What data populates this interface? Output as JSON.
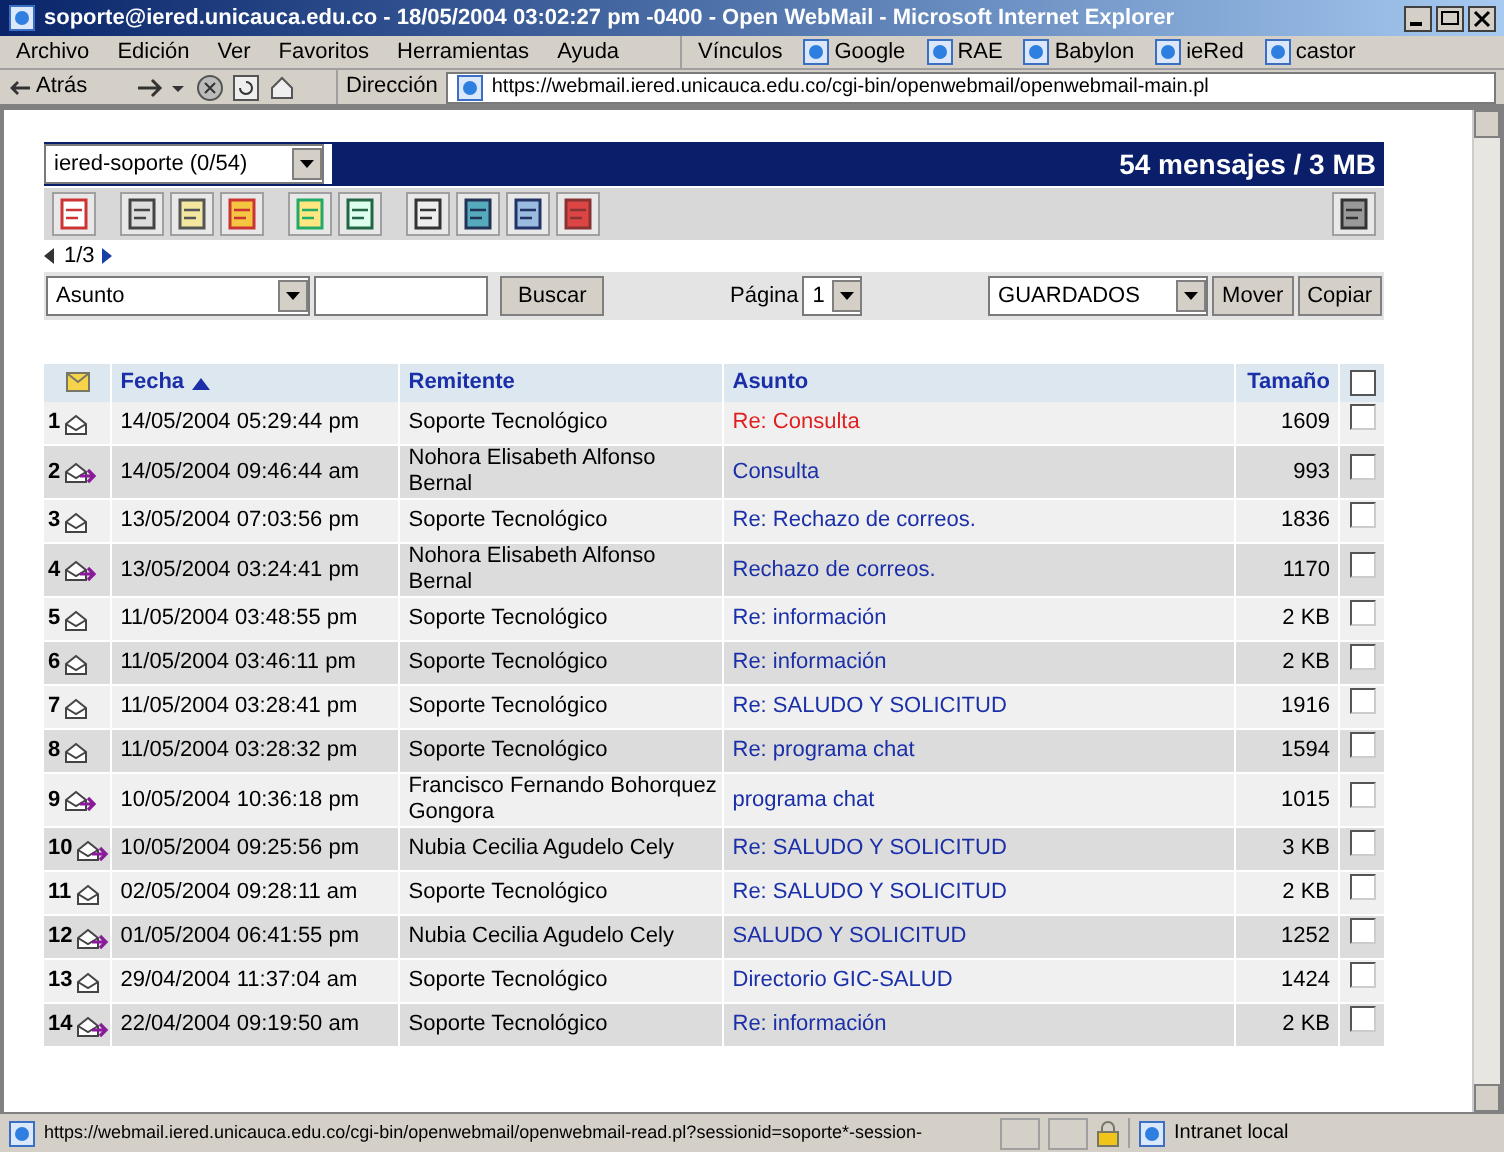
{
  "window": {
    "title": "soporte@iered.unicauca.edu.co - 18/05/2004 03:02:27 pm -0400 - Open WebMail - Microsoft Internet Explorer"
  },
  "menu": [
    "Archivo",
    "Edición",
    "Ver",
    "Favoritos",
    "Herramientas",
    "Ayuda"
  ],
  "links": {
    "label": "Vínculos",
    "items": [
      "Google",
      "RAE",
      "Babylon",
      "ieRed",
      "castor"
    ]
  },
  "nav": {
    "back": "Atrás",
    "address_label": "Dirección",
    "address": "https://webmail.iered.unicauca.edu.co/cgi-bin/openwebmail/openwebmail-main.pl"
  },
  "folder": {
    "value": "iered-soporte (0/54)",
    "summary": "54 mensajes / 3 MB"
  },
  "pager": "1/3",
  "search": {
    "field": "Asunto",
    "button": "Buscar",
    "page_label": "Página",
    "page": "1",
    "target": "GUARDADOS",
    "move": "Mover",
    "copy": "Copiar"
  },
  "table": {
    "columns": [
      "Fecha",
      "Remitente",
      "Asunto",
      "Tamaño"
    ],
    "select_all": {
      "checked": false
    },
    "rows": [
      {
        "num": "1",
        "kind": "plain",
        "date": "14/05/2004 05:29:44 pm",
        "sender": "Soporte Tecnológico",
        "subject": "Re: Consulta",
        "size": "1609",
        "current": true,
        "checked": false
      },
      {
        "num": "2",
        "kind": "arrow",
        "date": "14/05/2004 09:46:44 am",
        "sender": "Nohora Elisabeth Alfonso Bernal",
        "subject": "Consulta",
        "size": "993",
        "current": false,
        "checked": false
      },
      {
        "num": "3",
        "kind": "plain",
        "date": "13/05/2004 07:03:56 pm",
        "sender": "Soporte Tecnológico",
        "subject": "Re: Rechazo de correos.",
        "size": "1836",
        "current": false,
        "checked": false
      },
      {
        "num": "4",
        "kind": "arrow",
        "date": "13/05/2004 03:24:41 pm",
        "sender": "Nohora Elisabeth Alfonso Bernal",
        "subject": "Rechazo de correos.",
        "size": "1170",
        "current": false,
        "checked": false
      },
      {
        "num": "5",
        "kind": "plain",
        "date": "11/05/2004 03:48:55 pm",
        "sender": "Soporte Tecnológico",
        "subject": "Re: información",
        "size": "2 KB",
        "current": false,
        "checked": false
      },
      {
        "num": "6",
        "kind": "plain",
        "date": "11/05/2004 03:46:11 pm",
        "sender": "Soporte Tecnológico",
        "subject": "Re: información",
        "size": "2 KB",
        "current": false,
        "checked": false
      },
      {
        "num": "7",
        "kind": "plain",
        "date": "11/05/2004 03:28:41 pm",
        "sender": "Soporte Tecnológico",
        "subject": "Re: SALUDO Y SOLICITUD",
        "size": "1916",
        "current": false,
        "checked": false
      },
      {
        "num": "8",
        "kind": "plain",
        "date": "11/05/2004 03:28:32 pm",
        "sender": "Soporte Tecnológico",
        "subject": "Re: programa chat",
        "size": "1594",
        "current": false,
        "checked": false
      },
      {
        "num": "9",
        "kind": "arrow",
        "date": "10/05/2004 10:36:18 pm",
        "sender": "Francisco Fernando Bohorquez Gongora",
        "subject": "programa chat",
        "size": "1015",
        "current": false,
        "checked": false
      },
      {
        "num": "10",
        "kind": "arrow",
        "date": "10/05/2004 09:25:56 pm",
        "sender": "Nubia Cecilia Agudelo Cely",
        "subject": "Re: SALUDO Y SOLICITUD",
        "size": "3 KB",
        "current": false,
        "checked": false
      },
      {
        "num": "11",
        "kind": "plain",
        "date": "02/05/2004 09:28:11 am",
        "sender": "Soporte Tecnológico",
        "subject": "Re: SALUDO Y SOLICITUD",
        "size": "2 KB",
        "current": false,
        "checked": false
      },
      {
        "num": "12",
        "kind": "arrow",
        "date": "01/05/2004 06:41:55 pm",
        "sender": "Nubia Cecilia Agudelo Cely",
        "subject": "SALUDO Y SOLICITUD",
        "size": "1252",
        "current": false,
        "checked": false
      },
      {
        "num": "13",
        "kind": "plain",
        "date": "29/04/2004 11:37:04 am",
        "sender": "Soporte Tecnológico",
        "subject": "Directorio GIC-SALUD",
        "size": "1424",
        "current": false,
        "checked": false
      },
      {
        "num": "14",
        "kind": "arrow",
        "date": "22/04/2004 09:19:50 am",
        "sender": "Soporte Tecnológico",
        "subject": "Re: información",
        "size": "2 KB",
        "current": false,
        "checked": false
      }
    ]
  },
  "status_bar": {
    "url": "https://webmail.iered.unicauca.edu.co/cgi-bin/openwebmail/openwebmail-read.pl?sessionid=soporte*-session-",
    "zone": "Intranet local"
  }
}
